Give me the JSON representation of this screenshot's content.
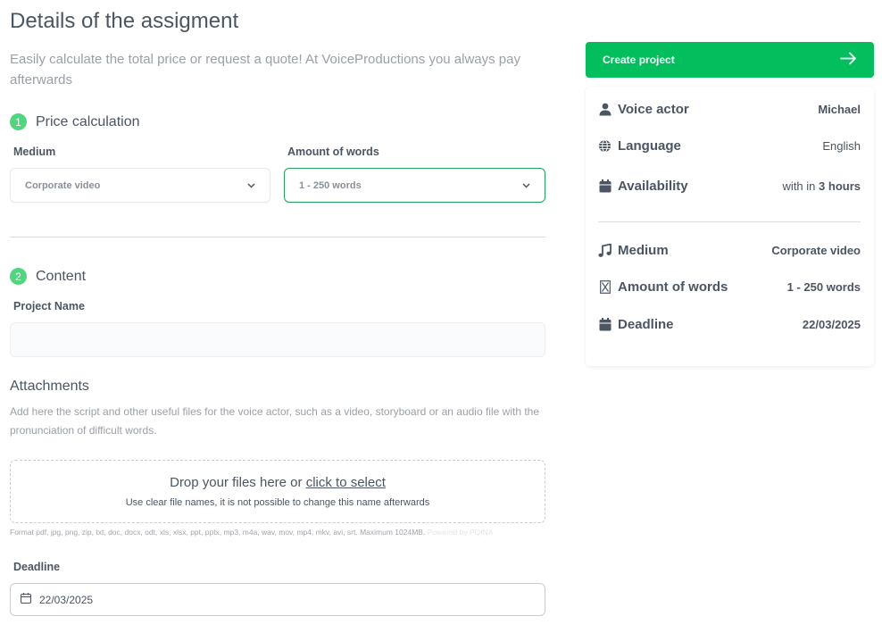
{
  "page": {
    "title": "Details of the assigment",
    "intro": "Easily calculate the total price or request a quote! At VoiceProductions you always pay afterwards"
  },
  "price_calculation": {
    "step_number": "1",
    "title": "Price calculation",
    "medium_label": "Medium",
    "medium_value": "Corporate video",
    "words_label": "Amount of words",
    "words_value": "1 - 250 words"
  },
  "content": {
    "step_number": "2",
    "title": "Content",
    "project_name_label": "Project Name",
    "project_name_value": "",
    "attachments_title": "Attachments",
    "attachments_hint": "Add here the script and other useful files for the voice actor, such as a video, storyboard or an audio file with the pronunciation of difficult words.",
    "dropzone_text": "Drop your files here or",
    "dropzone_link": "click to select",
    "dropzone_subtext": "Use clear file names, it is not possible to change this name afterwards",
    "formats_text": "Format pdf, jpg, png, zip, txt, doc, docx, odt, xls, xlsx, ppt, pptx, mp3, m4a, wav, mov, mp4, mkv, avi, srt. Maximum 1024MB.",
    "formats_faded": "Powered by PQINA",
    "deadline_label": "Deadline",
    "deadline_value": "22/03/2025"
  },
  "summary": {
    "cta_label": "Create project",
    "rows_top": [
      {
        "label": "Voice actor",
        "value": "Michael",
        "icon": "user-icon"
      },
      {
        "label": "Language",
        "value": "English",
        "icon": "globe-icon"
      },
      {
        "label": "Availability",
        "value_prefix": "with in",
        "value_bold": "3 hours",
        "icon": "calendar-icon"
      }
    ],
    "rows_bottom": [
      {
        "label": "Medium",
        "value": "Corporate video",
        "icon": "music-icon"
      },
      {
        "label": "Amount of words",
        "value": "1 - 250 words",
        "icon": "hourglass-icon"
      },
      {
        "label": "Deadline",
        "value": "22/03/2025",
        "icon": "calendar-icon"
      }
    ]
  },
  "colors": {
    "accent_green": "#03be5c",
    "step_badge": "#4fd67f",
    "active_border": "#22a35a"
  }
}
